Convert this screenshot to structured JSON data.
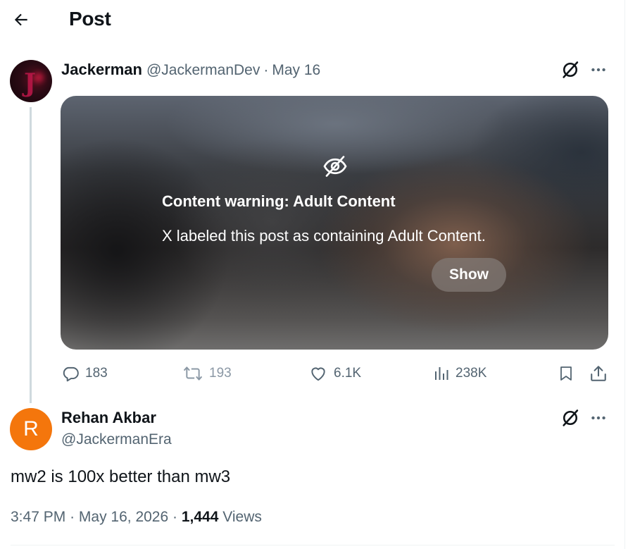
{
  "header": {
    "title": "Post",
    "back_icon": "arrow-left-icon"
  },
  "parent_post": {
    "display_name": "Jackerman",
    "handle": "@JackermanDev",
    "separator": "·",
    "date": "May 16",
    "grok_icon": "grok-icon",
    "more_icon": "more-horizontal-icon",
    "media_warning": {
      "icon": "eye-slash-icon",
      "title": "Content warning: Adult Content",
      "description": "X labeled this post as containing Adult Content.",
      "show_label": "Show"
    },
    "actions": {
      "replies": "183",
      "reposts": "193",
      "likes": "6.1K",
      "views": "238K",
      "bookmark_icon": "bookmark-icon",
      "share_icon": "share-icon"
    }
  },
  "reply_post": {
    "avatar_letter": "R",
    "avatar_color": "#f4760c",
    "display_name": "Rehan Akbar",
    "handle": "@JackermanEra",
    "text": "mw2 is 100x better than mw3",
    "time": "3:47 PM",
    "dot": "·",
    "date": "May 16, 2026",
    "views_count": "1,444",
    "views_label": "Views"
  },
  "colors": {
    "text_primary": "#0f1419",
    "text_secondary": "#536471",
    "thread_line": "#cfd9de",
    "divider": "#eff3f4"
  }
}
